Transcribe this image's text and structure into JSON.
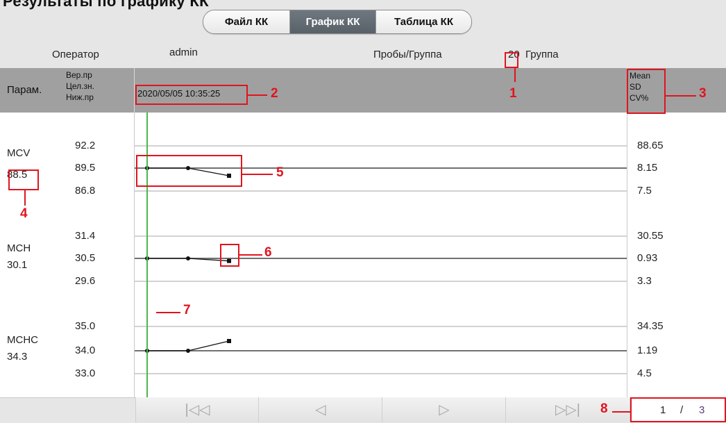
{
  "header": {
    "title": "Результаты по графику КК"
  },
  "tabs": [
    {
      "label": "Файл КК"
    },
    {
      "label": "График КК"
    },
    {
      "label": "Таблица КК"
    }
  ],
  "info": {
    "operator_label": "Оператор",
    "operator_value": "admin",
    "samples_label": "Пробы/Группа",
    "samples_value": "20",
    "group_label": "Группа"
  },
  "columns": {
    "param_label": "Парам.",
    "upper_label": "Вер.пр",
    "target_label": "Цел.зн.",
    "lower_label": "Ниж.пр",
    "datetime": "2020/05/05 10:35:25",
    "mean_label": "Mean",
    "sd_label": "SD",
    "cv_label": "CV%"
  },
  "parameters": [
    {
      "name": "MCV",
      "value": "88.5",
      "upper": "92.2",
      "target": "89.5",
      "lower": "86.8",
      "mean": "88.65",
      "sd": "8.15",
      "cv": "7.5",
      "points": [
        89.5,
        89.5,
        88.6
      ]
    },
    {
      "name": "MCH",
      "value": "30.1",
      "upper": "31.4",
      "target": "30.5",
      "lower": "29.6",
      "mean": "30.55",
      "sd": "0.93",
      "cv": "3.3",
      "points": [
        30.5,
        30.5,
        30.4
      ]
    },
    {
      "name": "MCHC",
      "value": "34.3",
      "upper": "35.0",
      "target": "34.0",
      "lower": "33.0",
      "mean": "34.35",
      "sd": "1.19",
      "cv": "4.5",
      "points": [
        34.0,
        34.0,
        34.4
      ]
    }
  ],
  "callouts": [
    "1",
    "2",
    "3",
    "4",
    "5",
    "6",
    "7",
    "8"
  ],
  "nav": {
    "first": "|◁◁",
    "prev": "◁",
    "next": "▷",
    "last": "▷▷|"
  },
  "pagination": {
    "current": "1",
    "separator": "/",
    "total": "3"
  },
  "colors": {
    "accent_red": "#e0141e",
    "cursor_green": "#4cb84c",
    "active_tab": "#5f676f"
  }
}
